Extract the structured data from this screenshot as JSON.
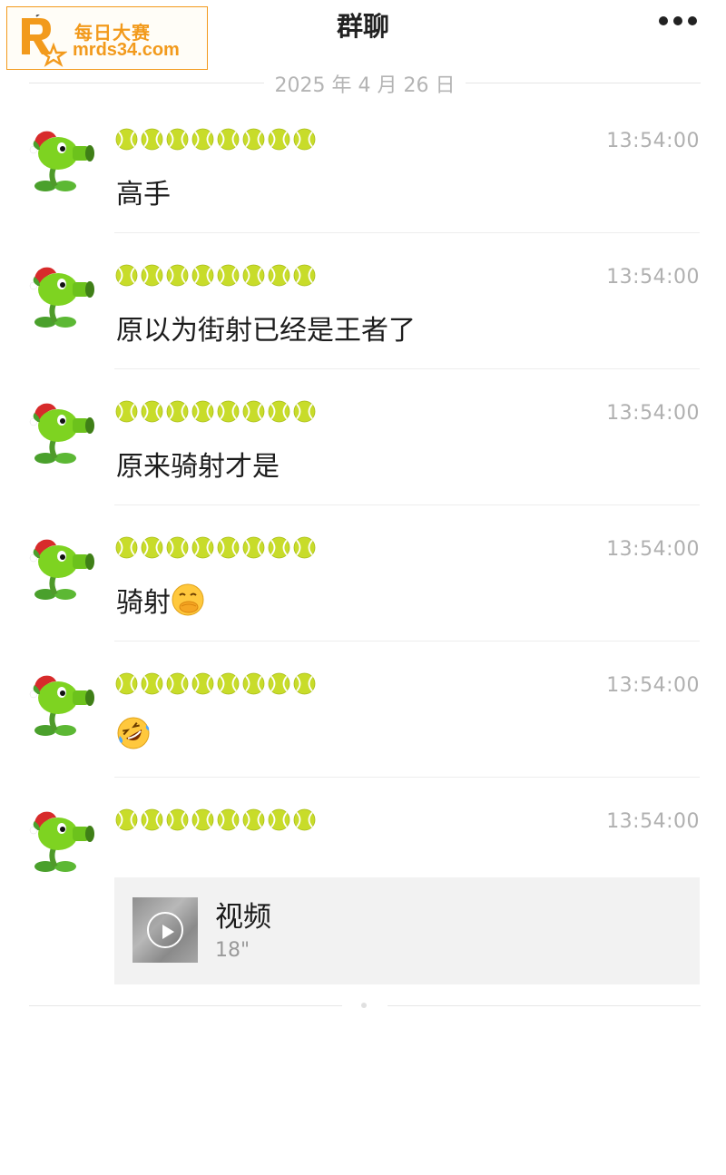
{
  "watermark": {
    "cn": "每日大赛",
    "en": "mrds34.com"
  },
  "header": {
    "title": "群聊",
    "menu_icon": "more-dots-icon"
  },
  "date_divider": "2025 年 4 月 26 日",
  "sender_name_emoji": "tennis-ball",
  "sender_name_count": 8,
  "messages": [
    {
      "time": "13:54:00",
      "text": "高手"
    },
    {
      "time": "13:54:00",
      "text": "原以为街射已经是王者了"
    },
    {
      "time": "13:54:00",
      "text": "原来骑射才是"
    },
    {
      "time": "13:54:00",
      "text": "骑射",
      "emoji": "face-with-hand-over-mouth"
    },
    {
      "time": "13:54:00",
      "text": "",
      "emoji": "rolling-on-floor-laughing"
    },
    {
      "time": "13:54:00",
      "video": {
        "label": "视频",
        "duration": "18\""
      }
    }
  ],
  "colors": {
    "accent_logo": "#f29a1c",
    "time_gray": "#b0b0b0",
    "card_bg": "#f2f2f2",
    "ball_green": "#c8dc2a"
  }
}
